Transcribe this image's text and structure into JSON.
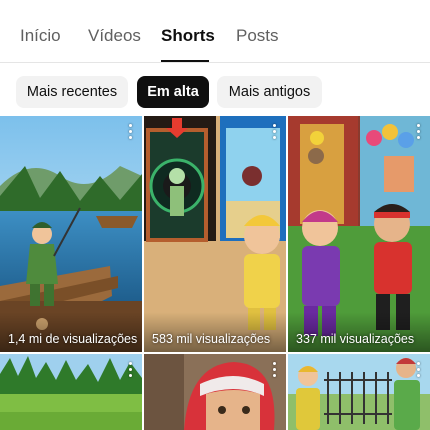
{
  "tabs": [
    {
      "label": "Início"
    },
    {
      "label": "Vídeos"
    },
    {
      "label": "Shorts"
    },
    {
      "label": "Posts"
    }
  ],
  "active_tab": "Shorts",
  "filters": [
    {
      "label": "Mais recentes"
    },
    {
      "label": "Em alta"
    },
    {
      "label": "Mais antigos"
    }
  ],
  "active_filter": "Em alta",
  "shorts": [
    {
      "views": "1,4 mi de visualizações",
      "thumbnail": "boy-fishing-on-lake-dock"
    },
    {
      "views": "583 mil visualizações",
      "thumbnail": "boy-choosing-portal-doors"
    },
    {
      "views": "337 mil visualizações",
      "thumbnail": "two-boys-party-room"
    },
    {
      "views": "",
      "thumbnail": "green-meadow-forest"
    },
    {
      "views": "",
      "thumbnail": "girl-red-hair-closeup"
    },
    {
      "views": "",
      "thumbnail": "boys-by-iron-fence"
    }
  ],
  "colors": {
    "active_chip": "#0f0f0f",
    "chip": "#f2f2f2",
    "inactive_tab": "#606060"
  }
}
